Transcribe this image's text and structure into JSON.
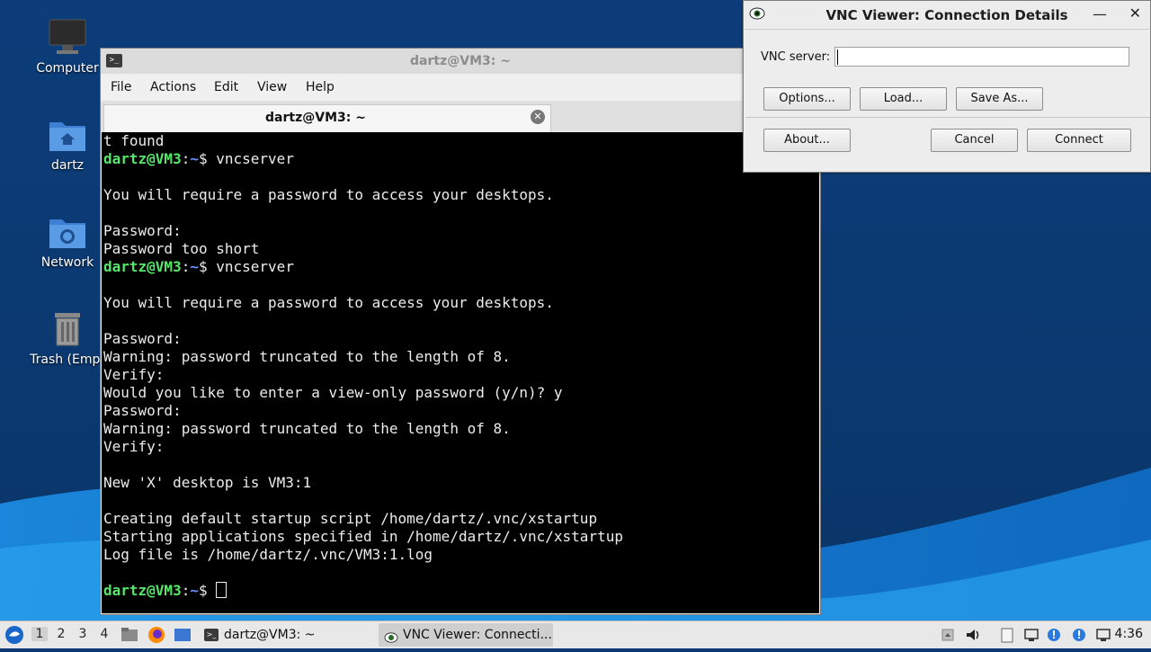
{
  "desktop": {
    "icons": [
      {
        "label": "Computer"
      },
      {
        "label": "dartz"
      },
      {
        "label": "Network"
      },
      {
        "label": "Trash (Empt"
      }
    ]
  },
  "terminal": {
    "title": "dartz@VM3: ~",
    "menu": [
      "File",
      "Actions",
      "Edit",
      "View",
      "Help"
    ],
    "tab_label": "dartz@VM3: ~",
    "prompt_user": "dartz@VM3",
    "prompt_sep": ":",
    "prompt_path": "~",
    "prompt_dollar": "$ ",
    "lines": [
      {
        "text": "t found"
      },
      {
        "prompt": true,
        "cmd": "vncserver"
      },
      {
        "text": ""
      },
      {
        "text": "You will require a password to access your desktops."
      },
      {
        "text": ""
      },
      {
        "text": "Password:"
      },
      {
        "text": "Password too short"
      },
      {
        "prompt": true,
        "cmd": "vncserver"
      },
      {
        "text": ""
      },
      {
        "text": "You will require a password to access your desktops."
      },
      {
        "text": ""
      },
      {
        "text": "Password:"
      },
      {
        "text": "Warning: password truncated to the length of 8."
      },
      {
        "text": "Verify:"
      },
      {
        "text": "Would you like to enter a view-only password (y/n)? y"
      },
      {
        "text": "Password:"
      },
      {
        "text": "Warning: password truncated to the length of 8."
      },
      {
        "text": "Verify:"
      },
      {
        "text": ""
      },
      {
        "text": "New 'X' desktop is VM3:1"
      },
      {
        "text": ""
      },
      {
        "text": "Creating default startup script /home/dartz/.vnc/xstartup"
      },
      {
        "text": "Starting applications specified in /home/dartz/.vnc/xstartup"
      },
      {
        "text": "Log file is /home/dartz/.vnc/VM3:1.log"
      },
      {
        "text": ""
      },
      {
        "prompt": true,
        "cmd": "",
        "cursor": true
      }
    ]
  },
  "vnc_dialog": {
    "title": "VNC Viewer: Connection Details",
    "server_label": "VNC server:",
    "server_value": "",
    "buttons": {
      "options": "Options...",
      "load": "Load...",
      "save_as": "Save As...",
      "about": "About...",
      "cancel": "Cancel",
      "connect": "Connect"
    }
  },
  "taskbar": {
    "workspaces": [
      "1",
      "2",
      "3",
      "4"
    ],
    "active_workspace": "1",
    "tasks": [
      {
        "label": "dartz@VM3: ~"
      },
      {
        "label": "VNC Viewer: Connecti..."
      }
    ],
    "clock": "4:36"
  },
  "colors": {
    "prompt_user": "#55e66a",
    "prompt_path": "#6f8fff",
    "desktop_bg": "#0b3a74"
  }
}
